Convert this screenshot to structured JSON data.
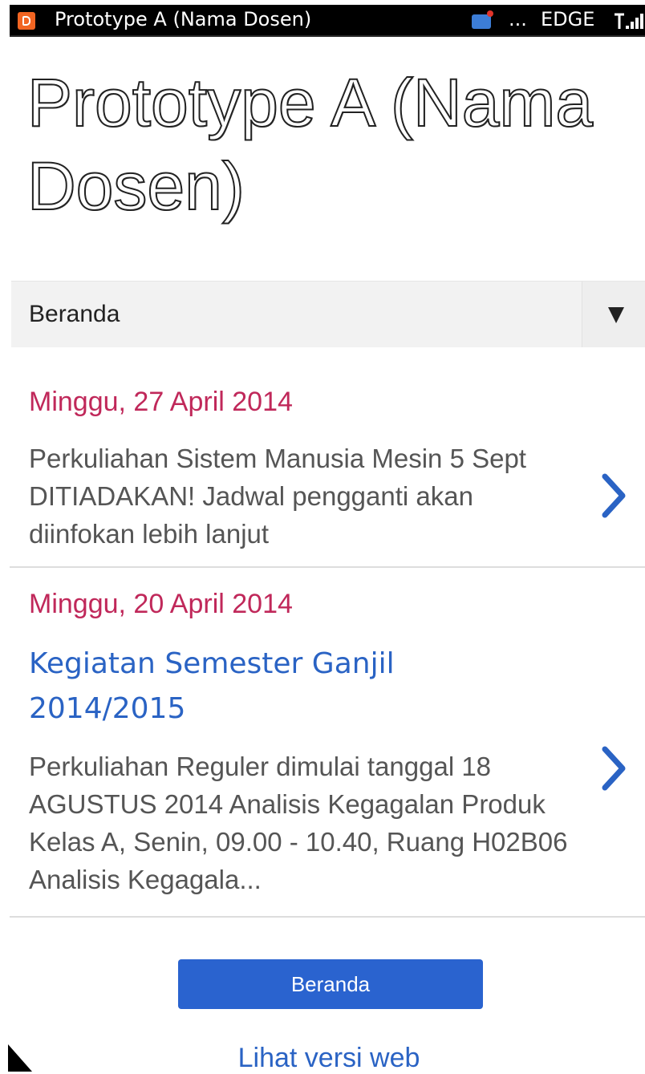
{
  "status_bar": {
    "app_title": "Prototype A (Nama Dosen)",
    "ellipsis": "...",
    "network": "EDGE",
    "app_icon": "blogger-icon",
    "message_icon": "message-notification-icon",
    "signal_icon": "signal-strength-icon"
  },
  "blog": {
    "title": "Prototype A (Nama Dosen)"
  },
  "nav": {
    "selected": "Beranda",
    "arrow_icon": "dropdown-arrow-icon"
  },
  "posts": [
    {
      "date": "Minggu, 27 April 2014",
      "title": "",
      "snippet": "Perkuliahan Sistem Manusia Mesin 5 Sept DITIADAKAN! Jadwal pengganti akan diinfokan lebih lanjut"
    },
    {
      "date": "Minggu, 20 April 2014",
      "title": "Kegiatan Semester Ganjil 2014/2015",
      "snippet": "Perkuliahan Reguler dimulai tanggal 18 AGUSTUS 2014 Analisis Kegagalan Produk Kelas A, Senin, 09.00 - 10.40, Ruang H02B06 Analisis Kegagala..."
    }
  ],
  "footer": {
    "home_button": "Beranda",
    "web_version_link": "Lihat versi web"
  },
  "colors": {
    "date": "#c0285a",
    "link": "#2a63c4",
    "button": "#2a63cf",
    "app_icon": "#f26522"
  }
}
